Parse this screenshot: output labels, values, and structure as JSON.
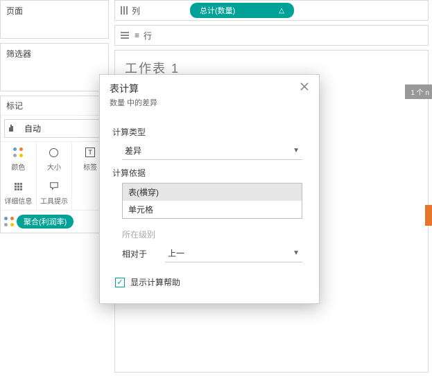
{
  "panels": {
    "pages": "页面",
    "filters": "筛选器",
    "marks": "标记"
  },
  "marks": {
    "auto": "自动",
    "color": "颜色",
    "size": "大小",
    "label": "标签",
    "detail": "详细信息",
    "tooltip": "工具提示"
  },
  "marks_pill": "聚合(利润率)",
  "shelves": {
    "columns": "列",
    "rows": "行",
    "columns_pill": "总计(数量)",
    "pill_delta": "△"
  },
  "sheet_title": "工作表 1",
  "right_badge": "1 个 n",
  "dialog": {
    "title": "表计算",
    "subtitle": "数量 中的差异",
    "calc_type_label": "计算类型",
    "calc_type_value": "差异",
    "compute_label": "计算依据",
    "compute_items": [
      "表(横穿)",
      "单元格"
    ],
    "level_label": "所在级别",
    "relative_label": "相对于",
    "relative_value": "上一",
    "show_help": "显示计算帮助"
  }
}
